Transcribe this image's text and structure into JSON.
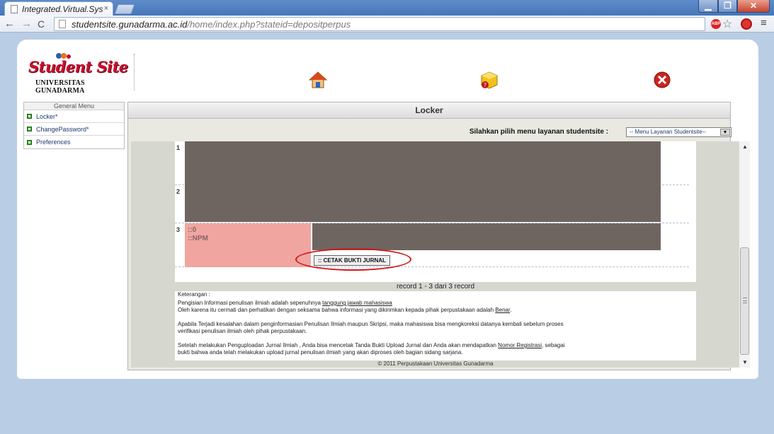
{
  "browser": {
    "tab_title": "Integrated.Virtual.Sys",
    "tab_close": "×",
    "url_domain": "studentsite.gunadarma.ac.id",
    "url_path": "/home/index.php?stateid=depositperpus",
    "abp_label": "ABP",
    "back_icon": "←",
    "forward_icon": "→",
    "reload_icon": "C",
    "star_icon": "☆",
    "menu_icon": "≡",
    "min_icon": "▁",
    "max_icon": "❐",
    "close_icon": "✕"
  },
  "header": {
    "logo_title": "Student Site",
    "logo_subtitle": "UNIVERSITAS GUNADARMA",
    "nav_icons": [
      "home-icon",
      "help-icon",
      "exit-icon"
    ]
  },
  "sidebar": {
    "heading": "General Menu",
    "items": [
      {
        "label": "Locker*"
      },
      {
        "label": "ChangePassword*"
      },
      {
        "label": "Preferences"
      }
    ]
  },
  "main": {
    "title": "Locker",
    "service_label": "Silahkan pilih menu layanan studentsite :",
    "service_select_value": "-- Menu Layanan Studentsite--",
    "select_arrow": "▼"
  },
  "records": {
    "rows": [
      {
        "num": "1"
      },
      {
        "num": "2"
      },
      {
        "num": "3",
        "line1": "::0",
        "line2": "::NPM"
      }
    ],
    "cetak_button": ":: CETAK BUKTI JURNAL",
    "record_info": "record 1 - 3 dari 3 record"
  },
  "notes": {
    "heading": "Keterangan :",
    "p1_before": "Pengisian Informasi penulisan ilmiah adalah sepenuhnya ",
    "p1_link": "tanggung jawab mahasiswa",
    "p2_before": "Oleh karena itu cermati dan perhatikan dengan seksama bahwa informasi yang dikirimkan kepada pihak perpustakaan adalah ",
    "p2_link": "Benar",
    "p2_after": ".",
    "p3_line1": "Apabila Terjadi kesalahan dalam penginformasian Penulisan Ilmiah maupun Skripsi, maka mahasiswa bisa mengkoreksi datanya kembali sebelum proses",
    "p3_line2": "verifikasi penulisan ilmiah oleh pihak perpustakaan.",
    "p4_before": "Setelah melakukan Penguploadan Jurnal Ilmiah , Anda bisa mencetak Tanda Bukti Upload Jurnal dan Anda akan mendapatkan ",
    "p4_link": "Nomor Registrasi",
    "p4_after": ", sebagai",
    "p4_line2": "bukti bahwa anda telah melakukan upload jurnal penulisan ilmiah yang akan diproses oleh bagian sidang sarjana."
  },
  "footer": {
    "copyright": "© 2011 Perpustakaan Universitas Gunadarma"
  },
  "scroll": {
    "up_arrow": "▲",
    "down_arrow": "▼"
  }
}
